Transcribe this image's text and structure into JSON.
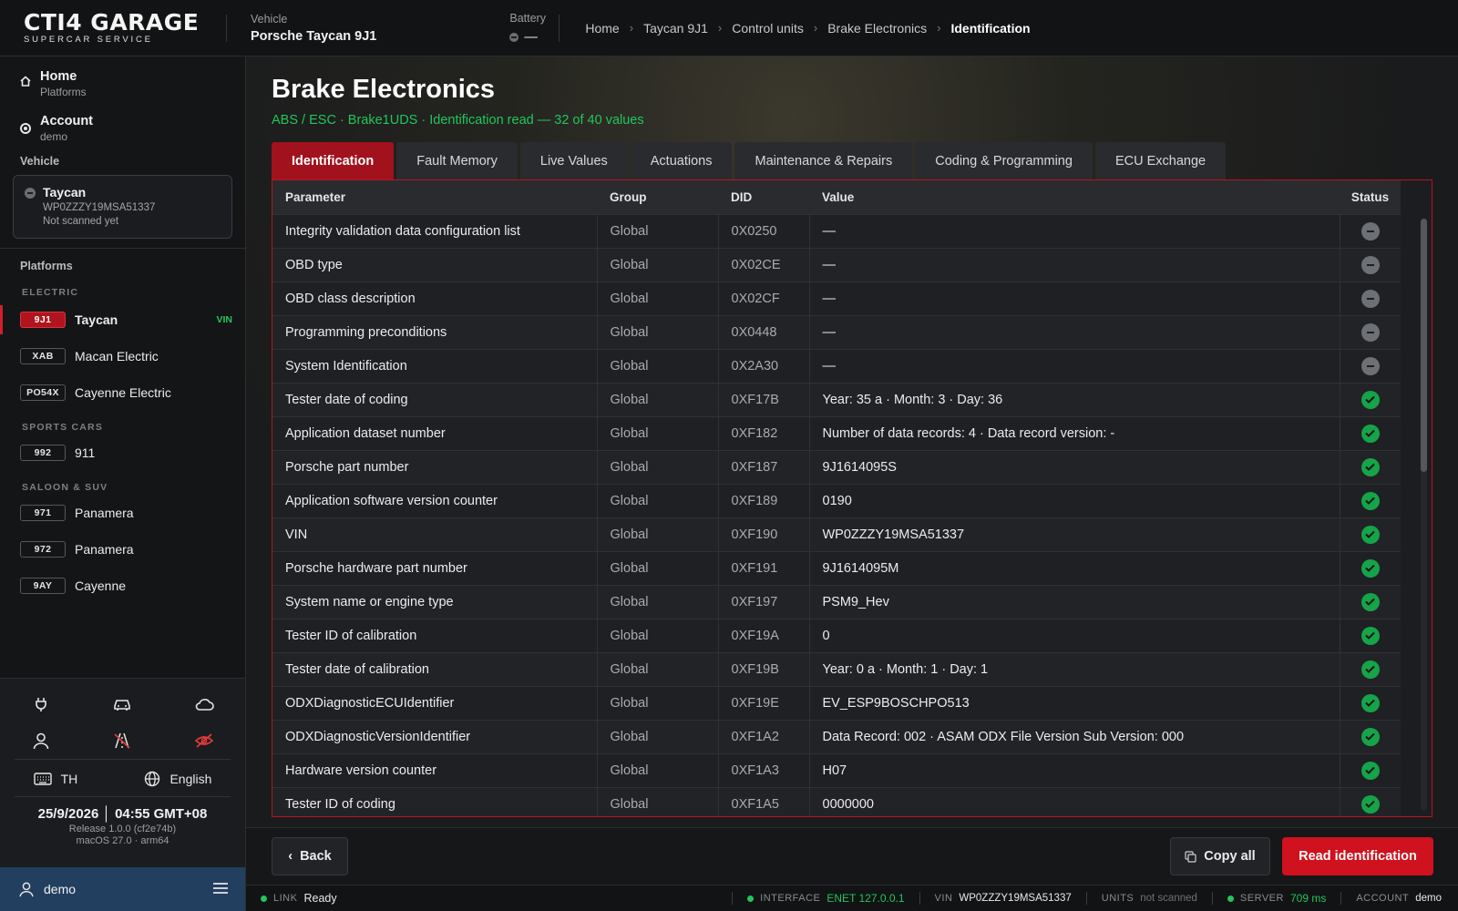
{
  "app": {
    "logo_line1": "CTI4 GARAGE",
    "logo_line2": "SUPERCAR SERVICE"
  },
  "topbar": {
    "vehicle_label": "Vehicle",
    "vehicle_value": "Porsche Taycan 9J1",
    "battery_label": "Battery",
    "battery_value": "—",
    "breadcrumb": [
      "Home",
      "Taycan 9J1",
      "Control units",
      "Brake Electronics",
      "Identification"
    ]
  },
  "sidebar": {
    "nav": [
      {
        "title": "Home",
        "subtitle": "Platforms",
        "icon": "home-icon"
      },
      {
        "title": "Account",
        "subtitle": "demo",
        "icon": "account-radio-icon"
      }
    ],
    "vehicle_section": "Vehicle",
    "vehicle_card": {
      "name": "Taycan",
      "vin": "WP0ZZZY19MSA51337",
      "status": "Not scanned yet"
    },
    "platforms_section": "Platforms",
    "groups": [
      {
        "label": "ELECTRIC",
        "items": [
          {
            "badge": "9J1",
            "name": "Taycan",
            "tag": "VIN",
            "active": true
          },
          {
            "badge": "XAB",
            "name": "Macan Electric"
          },
          {
            "badge": "PO54X",
            "name": "Cayenne Electric"
          }
        ]
      },
      {
        "label": "SPORTS CARS",
        "items": [
          {
            "badge": "992",
            "name": "911"
          }
        ]
      },
      {
        "label": "SALOON & SUV",
        "items": [
          {
            "badge": "971",
            "name": "Panamera"
          },
          {
            "badge": "972",
            "name": "Panamera"
          },
          {
            "badge": "9AY",
            "name": "Cayenne"
          }
        ]
      }
    ],
    "tools_icons": [
      "plug-icon",
      "car-icon",
      "cloud-icon",
      "user-icon",
      "road-off-icon",
      "eye-off-icon"
    ],
    "keyboard": "TH",
    "language": "English",
    "datetime": "25/9/2026 │ 04:55 GMT+08",
    "release": "Release 1.0.0 (cf2e74b)",
    "os": "macOS 27.0 · arm64",
    "user": "demo"
  },
  "main": {
    "title": "Brake Electronics",
    "subtitle": "ABS / ESC · Brake1UDS · Identification read — 32 of 40 values",
    "tabs": [
      "Identification",
      "Fault Memory",
      "Live Values",
      "Actuations",
      "Maintenance & Repairs",
      "Coding & Programming",
      "ECU Exchange"
    ],
    "columns": {
      "parameter": "Parameter",
      "group": "Group",
      "did": "DID",
      "value": "Value",
      "status": "Status"
    },
    "rows": [
      {
        "parameter": "Integrity validation data configuration list",
        "group": "Global",
        "did": "0X0250",
        "value": "—",
        "status": "none"
      },
      {
        "parameter": "OBD type",
        "group": "Global",
        "did": "0X02CE",
        "value": "—",
        "status": "none"
      },
      {
        "parameter": "OBD class description",
        "group": "Global",
        "did": "0X02CF",
        "value": "—",
        "status": "none"
      },
      {
        "parameter": "Programming preconditions",
        "group": "Global",
        "did": "0X0448",
        "value": "—",
        "status": "none"
      },
      {
        "parameter": "System Identification",
        "group": "Global",
        "did": "0X2A30",
        "value": "—",
        "status": "none"
      },
      {
        "parameter": "Tester date of coding",
        "group": "Global",
        "did": "0XF17B",
        "value": "Year: 35 a · Month: 3 · Day: 36",
        "status": "ok"
      },
      {
        "parameter": "Application dataset number",
        "group": "Global",
        "did": "0XF182",
        "value": "Number of data records: 4 · Data record version: -",
        "status": "ok"
      },
      {
        "parameter": "Porsche part number",
        "group": "Global",
        "did": "0XF187",
        "value": "9J1614095S",
        "status": "ok"
      },
      {
        "parameter": "Application software version counter",
        "group": "Global",
        "did": "0XF189",
        "value": "0190",
        "status": "ok"
      },
      {
        "parameter": "VIN",
        "group": "Global",
        "did": "0XF190",
        "value": "WP0ZZZY19MSA51337",
        "status": "ok"
      },
      {
        "parameter": "Porsche hardware part number",
        "group": "Global",
        "did": "0XF191",
        "value": "9J1614095M",
        "status": "ok"
      },
      {
        "parameter": "System name or engine type",
        "group": "Global",
        "did": "0XF197",
        "value": "PSM9_Hev",
        "status": "ok"
      },
      {
        "parameter": "Tester ID of calibration",
        "group": "Global",
        "did": "0XF19A",
        "value": "0",
        "status": "ok"
      },
      {
        "parameter": "Tester date of calibration",
        "group": "Global",
        "did": "0XF19B",
        "value": "Year: 0 a · Month: 1 · Day: 1",
        "status": "ok"
      },
      {
        "parameter": "ODXDiagnosticECUIdentifier",
        "group": "Global",
        "did": "0XF19E",
        "value": "EV_ESP9BOSCHPO513",
        "status": "ok"
      },
      {
        "parameter": "ODXDiagnosticVersionIdentifier",
        "group": "Global",
        "did": "0XF1A2",
        "value": "Data Record: 002 · ASAM ODX File Version Sub Version: 000",
        "status": "ok"
      },
      {
        "parameter": "Hardware version counter",
        "group": "Global",
        "did": "0XF1A3",
        "value": "H07",
        "status": "ok"
      },
      {
        "parameter": "Tester ID of coding",
        "group": "Global",
        "did": "0XF1A5",
        "value": "0000000",
        "status": "ok"
      }
    ]
  },
  "actions": {
    "back": "Back",
    "copy_all": "Copy all",
    "read": "Read identification"
  },
  "statusbar": {
    "link_label": "LINK",
    "link_value": "Ready",
    "interface_label": "INTERFACE",
    "interface_value": "ENET 127.0.0.1",
    "vin_label": "VIN",
    "vin_value": "WP0ZZZY19MSA51337",
    "units_label": "UNITS",
    "units_value": "not scanned",
    "server_label": "SERVER",
    "server_value": "709 ms",
    "account_label": "ACCOUNT",
    "account_value": "demo"
  },
  "colors": {
    "accent": "#d0111e",
    "ok": "#16a34a",
    "subtitle": "#22c55e",
    "userbar": "#233f60"
  }
}
